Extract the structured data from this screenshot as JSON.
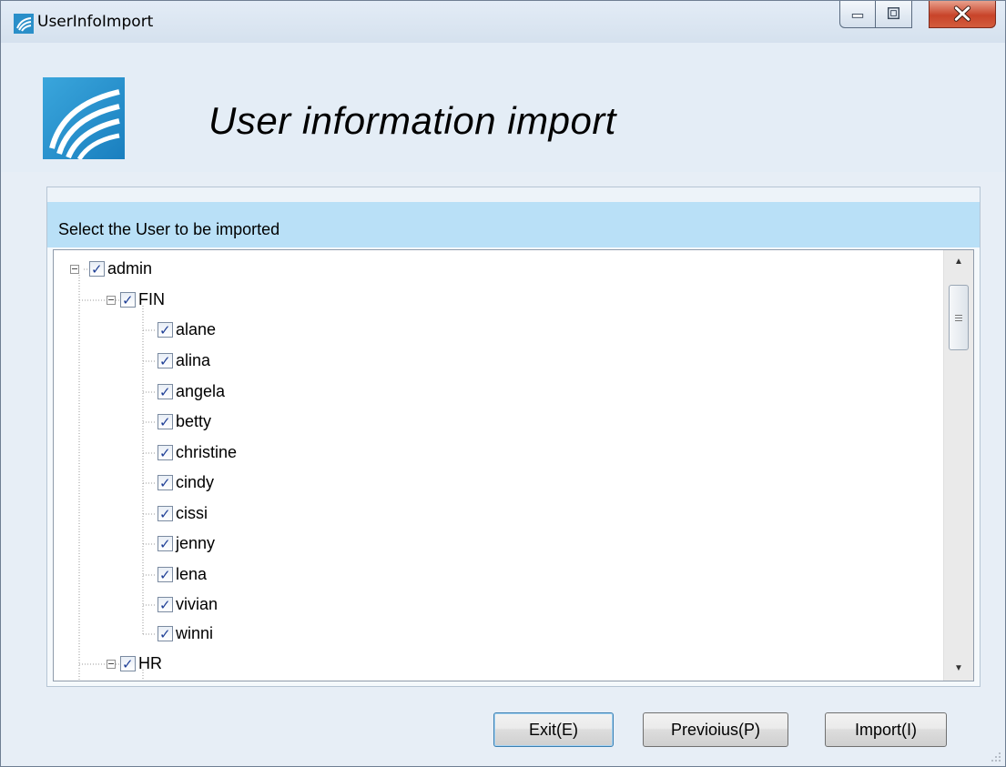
{
  "window": {
    "title": "UserInfoImport",
    "icon": "app-wave-icon",
    "controls": {
      "minimize": "minimize-icon",
      "maximize": "maximize-icon",
      "close": "close-icon"
    }
  },
  "header": {
    "heading": "User information import",
    "logo": "wave-logo-icon"
  },
  "panel": {
    "label": "Select the User to  be imported"
  },
  "tree": {
    "check_mark": "✓",
    "nodes": [
      {
        "label": "admin",
        "level": 0,
        "checked": true,
        "expanded": true
      },
      {
        "label": "FIN",
        "level": 1,
        "checked": true,
        "expanded": true
      },
      {
        "label": "alane",
        "level": 2,
        "checked": true
      },
      {
        "label": "alina",
        "level": 2,
        "checked": true
      },
      {
        "label": "angela",
        "level": 2,
        "checked": true
      },
      {
        "label": "betty",
        "level": 2,
        "checked": true
      },
      {
        "label": "christine",
        "level": 2,
        "checked": true
      },
      {
        "label": "cindy",
        "level": 2,
        "checked": true
      },
      {
        "label": "cissi",
        "level": 2,
        "checked": true
      },
      {
        "label": "jenny",
        "level": 2,
        "checked": true
      },
      {
        "label": "lena",
        "level": 2,
        "checked": true
      },
      {
        "label": "vivian",
        "level": 2,
        "checked": true
      },
      {
        "label": "winni",
        "level": 2,
        "checked": true
      },
      {
        "label": "HR",
        "level": 1,
        "checked": true,
        "expanded": true
      }
    ]
  },
  "scrollbar": {
    "up": "▲",
    "down": "▼",
    "position": 0.1
  },
  "buttons": {
    "exit": "Exit(E)",
    "previous": "Previoius(P)",
    "import": "Import(I)"
  }
}
